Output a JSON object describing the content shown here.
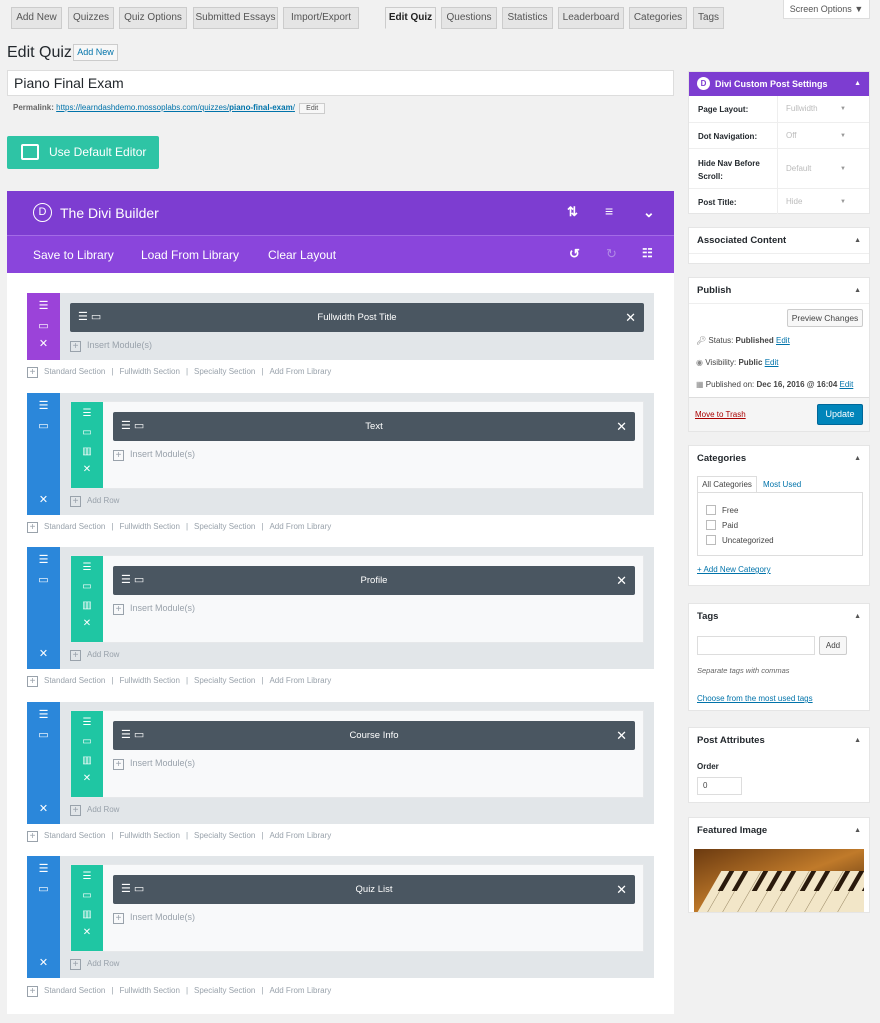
{
  "nav_tabs": [
    {
      "label": "Add New",
      "active": false
    },
    {
      "label": "Quizzes",
      "active": false
    },
    {
      "label": "Quiz Options",
      "active": false
    },
    {
      "label": "Submitted Essays",
      "active": false
    },
    {
      "label": "Import/Export",
      "active": false
    },
    {
      "label": "Edit Quiz",
      "active": true
    },
    {
      "label": "Questions",
      "active": false
    },
    {
      "label": "Statistics",
      "active": false
    },
    {
      "label": "Leaderboard",
      "active": false
    },
    {
      "label": "Categories",
      "active": false
    },
    {
      "label": "Tags",
      "active": false
    }
  ],
  "screen_options": "Screen Options",
  "page": {
    "heading": "Edit Quiz",
    "add_new": "Add New",
    "title_value": "Piano Final Exam",
    "permalink_label": "Permalink:",
    "permalink_base": "https://learndashdemo.mossoplabs.com/quizzes/",
    "permalink_slug": "piano-final-exam",
    "permalink_end": "/",
    "permalink_edit": "Edit",
    "default_editor": "Use Default Editor"
  },
  "builder": {
    "title": "The Divi Builder",
    "logo_letter": "D",
    "save_to_library": "Save to Library",
    "load_from_library": "Load From Library",
    "clear_layout": "Clear Layout",
    "insert_modules": "Insert Module(s)",
    "add_row": "Add Row",
    "add_section_links": [
      "Standard Section",
      "Fullwidth Section",
      "Specialty Section",
      "Add From Library"
    ],
    "sections": [
      {
        "type": "fullwidth",
        "module": "Fullwidth Post Title"
      },
      {
        "type": "standard",
        "module": "Text"
      },
      {
        "type": "standard",
        "module": "Profile"
      },
      {
        "type": "standard",
        "module": "Course Info"
      },
      {
        "type": "standard",
        "module": "Quiz List"
      }
    ],
    "colors": {
      "header": "#7d3dd1",
      "fullwidth_section": "#9b43d9",
      "section": "#2b87da",
      "row": "#1fc6a3",
      "module": "#4a5661"
    }
  },
  "divi_settings": {
    "title": "Divi Custom Post Settings",
    "rows": [
      {
        "label": "Page Layout:",
        "value": "Fullwidth"
      },
      {
        "label": "Dot Navigation:",
        "value": "Off"
      },
      {
        "label": "Hide Nav Before Scroll:",
        "value": "Default"
      },
      {
        "label": "Post Title:",
        "value": "Hide"
      }
    ]
  },
  "associated_content": {
    "title": "Associated Content"
  },
  "publish": {
    "title": "Publish",
    "preview": "Preview Changes",
    "status_label": "Status:",
    "status_value": "Published",
    "visibility_label": "Visibility:",
    "visibility_value": "Public",
    "published_label": "Published on:",
    "published_value": "Dec 16, 2016 @ 16:04",
    "edit": "Edit",
    "trash": "Move to Trash",
    "update": "Update"
  },
  "categories": {
    "title": "Categories",
    "tab_all": "All Categories",
    "tab_most_used": "Most Used",
    "items": [
      "Free",
      "Paid",
      "Uncategorized"
    ],
    "add_new": "+ Add New Category"
  },
  "tags": {
    "title": "Tags",
    "input_value": "",
    "add": "Add",
    "hint": "Separate tags with commas",
    "choose": "Choose from the most used tags"
  },
  "post_attributes": {
    "title": "Post Attributes",
    "order_label": "Order",
    "order_value": "0"
  },
  "featured_image": {
    "title": "Featured Image"
  }
}
